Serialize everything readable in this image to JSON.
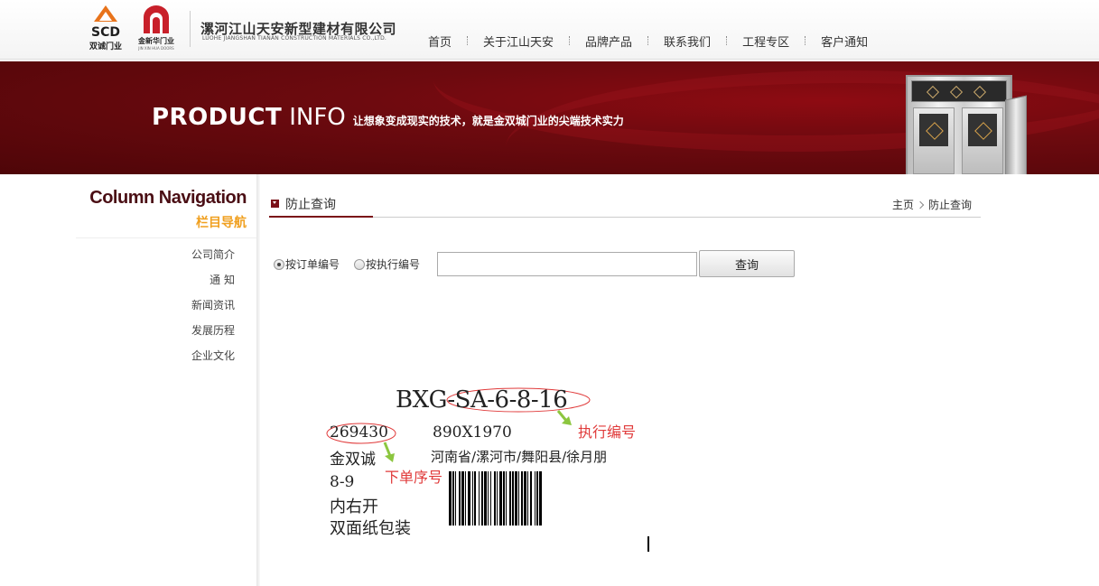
{
  "header": {
    "logo1_caption": "双诚门业",
    "logo1_mark": "SCD",
    "logo2_caption": "金新华门业",
    "logo2_en": "JIN XIN HUA DOORS",
    "company_cn": "漯河江山天安新型建材有限公司",
    "company_en": "LUOHE JIANGSHAN TIANAN CONSTRUCTION MATERIALS CO.,LTD."
  },
  "nav": {
    "items": [
      "首页",
      "关于江山天安",
      "品牌产品",
      "联系我们",
      "工程专区",
      "客户通知"
    ]
  },
  "banner": {
    "title_bold": "PRODUCT",
    "title_light": "INFO",
    "slogan": "让想象变成现实的技术，就是金双城门业的尖端技术实力"
  },
  "sidebar": {
    "heading_en": "Column Navigation",
    "heading_cn": "栏目导航",
    "items": [
      "公司简介",
      "通 知",
      "新闻资讯",
      "发展历程",
      "企业文化"
    ]
  },
  "main": {
    "title": "防止查询",
    "breadcrumb": {
      "home": "主页",
      "current": "防止查询"
    }
  },
  "query": {
    "radio_order": "按订单编号",
    "radio_exec": "按执行编号",
    "selected": "order",
    "input_value": "",
    "button_label": "查询"
  },
  "sample": {
    "exec_code": "BXG-SA-6-8-16",
    "order_no": "269430",
    "size": "890X1970",
    "brand": "金双诚",
    "address": "河南省/漯河市/舞阳县/徐月朋",
    "frame": "8-9",
    "opening": "内右开",
    "packing": "双面纸包装",
    "annotation_exec": "执行编号",
    "annotation_order": "下单序号"
  },
  "colors": {
    "brand_dark_red": "#7a1018",
    "banner_red": "#6d0a0f",
    "accent_orange": "#f0a020",
    "annotation_red": "#e03a3a",
    "annotation_green": "#8cc63f"
  }
}
